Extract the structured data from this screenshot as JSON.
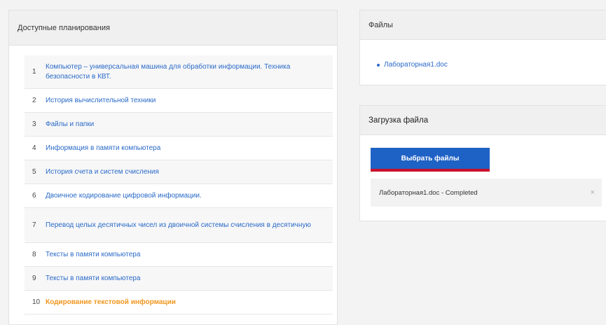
{
  "plans": {
    "title": "Доступные планирования",
    "items": [
      {
        "num": "1",
        "text": "Компьютер – универсальная машина для обработки информации. Техника безопасности в КВТ."
      },
      {
        "num": "2",
        "text": "История вычислительной техники"
      },
      {
        "num": "3",
        "text": "Файлы и папки"
      },
      {
        "num": "4",
        "text": "Информация в памяти компьютера"
      },
      {
        "num": "5",
        "text": "История счета и систем счисления"
      },
      {
        "num": "6",
        "text": "Двоичное кодирование цифровой информации."
      },
      {
        "num": "7",
        "text": "Перевод целых десятичных чисел из двоичной системы счисления в десятичную"
      },
      {
        "num": "8",
        "text": "Тексты в памяти компьютера"
      },
      {
        "num": "9",
        "text": "Тексты в памяти компьютера"
      },
      {
        "num": "10",
        "text": "Кодирование текстовой информации",
        "active": true
      }
    ]
  },
  "files": {
    "title": "Файлы",
    "items": [
      "Лабораторная1.doc"
    ]
  },
  "upload": {
    "title": "Загрузка файла",
    "button_label": "Выбрать файлы",
    "status_text": "Лабораторная1.doc - Completed",
    "close_symbol": "×"
  },
  "colors": {
    "link": "#2a6ac8",
    "active_link": "#f0961e",
    "button": "#1f62c5",
    "button_underline": "#c8102e"
  }
}
